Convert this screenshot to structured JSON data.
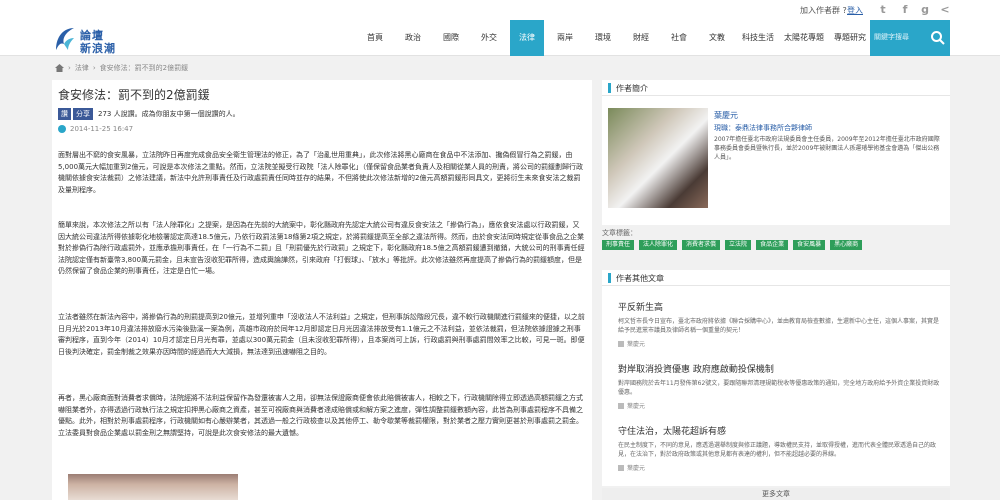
{
  "topbar": {
    "join": "加入作者群 ?",
    "login": "登入",
    "social": [
      "twitter-icon",
      "facebook-icon",
      "google-plus-icon",
      "share-icon"
    ]
  },
  "header": {
    "logo": {
      "line1": "論壇",
      "line2": "新浪潮"
    },
    "nav": [
      "首頁",
      "政治",
      "國際",
      "外交",
      "法律",
      "兩岸",
      "環境",
      "財經",
      "社會",
      "文教",
      "科技生活",
      "太陽花專題",
      "專題研究"
    ],
    "active": "法律",
    "search_placeholder": "關鍵字搜尋"
  },
  "breadcrumb": [
    "法律",
    "食安修法：罰不到的2億罰鍰"
  ],
  "article": {
    "title": "食安修法：罰不到的2億罰鍰",
    "fb": {
      "like": "讚",
      "share": "分享",
      "text": "273 人說讚。成為你朋友中第一個說讚的人。"
    },
    "date": "2014-11-25 16:47",
    "paragraphs": [
      "面對層出不窮的食安風暴，立法院昨日再度完成食品安全衛生管理法的修正，為了「治亂世用重典」，此次修法將黑心廠商在食品中不法添加、攙偽假冒行為之罰鍰，由5,000萬元大幅加重到2億元，可說是本次修法之重點。然而，立法院並擬受行政院「法人除罪化」（僅保留食品業者負責人及相關從業人員的刑責，將公司的罰鍰劃歸行政機關依據食安法裁罰）之修法建議，新法中允許刑事責任及行政處罰責任同時並存的結果，不但將使此次修法新增的2億元高額罰鍰形同具文，更將衍生未來食安法之裁罰及量刑程序。",
      "簡單來說，本次修法之所以有「法人除罪化」之提案，是因為在先前的大統案中，彰化縣政府先認定大統公司有違反食安法之「摻偽行為」，應依食安法處以行政罰鍰，又因大統公司違法所得依據彰化地檢署認定高達18.5億元，乃依行政罰法第18條第2項之規定，於將罰鍰提高至全部之違法所得。然而，由於食安法同時規定從事食品之企業對於摻偽行為除行政處罰外，並應承擔刑事責任，在「一行為不二罰」且「刑罰優先於行政罰」之規定下，彰化縣政府18.5億之高額罰鍰遭到撤銷，大統公司的刑事責任經法院認定僅有新臺幣3,800萬元罰金，且未宣告沒收犯罪所得，造成輿論譁然，引來政府「打假球」、「放水」等批評。此次修法雖然再度提高了摻偽行為的罰鍰額度，但是仍然保留了食品企業的刑事責任，注定是白忙一場。",
      "立法者雖然在新法內容中，將摻偽行為的刑罰提高到20億元，並增列重申「沒收法人不法利益」之規定，但刑事訴訟階段冗長，違不較行政機關進行罰鍰來的便捷，以之前日月光於2013年10月違法排放廢水污染後勁溪一案為例，高雄市政府於同年12月即認定日月光因違法排放受有1.1億元之不法利益，並依法裁罰，但法院依據證據之刑事審判程序，直到今年（2014）10月才認定日月光有罪，並處以300萬元罰金（且未沒收犯罪所得），且本案尚可上訴，行政處罰與刑事處罰間效率之比較，可見一斑。即便日後判決確定，罰金制裁之效果亦因時間的經過而大大減損，無法達到迅速嚇阻之目的。",
      "再者，黑心廠商面對消費者求償時，法院經將不法利益保留作為發還被害人之用，卻無法保證廠商便會依此賠償被害人，相較之下，行政機關除得立即透過高額罰鍰之方式嚇阻業者外，亦得透過行政執行法之規定扣押黑心廠商之資產，甚至可視廠商與消費者達成賠償或和解方案之進度，彈性調整罰鍰數額內容，此皆為刑事處罰程序不具備之優點。此外，相對於刑事處罰程序，行政機關如有心嚴辦業者，其透過一般之行政檢查以及其他停工、勒令歇業等裁罰權限，對於業者之壓力實則更甚於刑事處罰之罰金。立法委員對食品企業處以罰金刑之無謂堅持，可說是此次食安修法的最大遺憾。"
    ]
  },
  "author": {
    "heading": "作者簡介",
    "name": "葉慶元",
    "job": "現職：泰鼎法律事務所合夥律師",
    "bio": "2007年擔任臺北市政府法規委員會主任委員，2009年至2012年擔任臺北市政府國際事務委員會委員暨執行長，並於2009年被財團法人孫運璿學術基金會遴為「傑出公務人員」。"
  },
  "tags": {
    "label": "文章標籤：",
    "items": [
      "刑事責任",
      "法人除罪化",
      "消費者求償",
      "立法院",
      "食品企業",
      "食安風暴",
      "黑心廠商"
    ]
  },
  "others": {
    "heading": "作者其他文章",
    "items": [
      {
        "title": "平反新生高",
        "body": "柯文哲市長今日宣布，臺北市政府將依據《聯合採購申心》，並由教育局檢查數據，生還新中心主任，這個人事案，其實是給予民進黨市議員及律師名稱一個重量的契元！",
        "author": "葉慶元"
      },
      {
        "title": "對岸取消投資優惠 政府應啟動投保機制",
        "body": "對岸國務院於去年11月發佈第62號文，要跟隨聯邦清理規範稅收等優惠政策的通知，完全地方政府給予外資企業投資財政優惠。",
        "author": "葉慶元"
      },
      {
        "title": "守住法治，太陽花超訴有感",
        "body": "在民主制度下，不同的意見，應透過選舉制度與修正議題，導致權民支持，並取得授權，進而代表全體民眾透過自己的政見，在法治下，對於政府政策或其他意見都有表達的權利，但不能超越必要的界線。",
        "author": "葉慶元"
      }
    ]
  },
  "more": "更多文章",
  "colors": {
    "accent": "#2aa6c9",
    "tag": "#2e9e5a",
    "link": "#2a5fa8",
    "fb": "#3b5998"
  }
}
